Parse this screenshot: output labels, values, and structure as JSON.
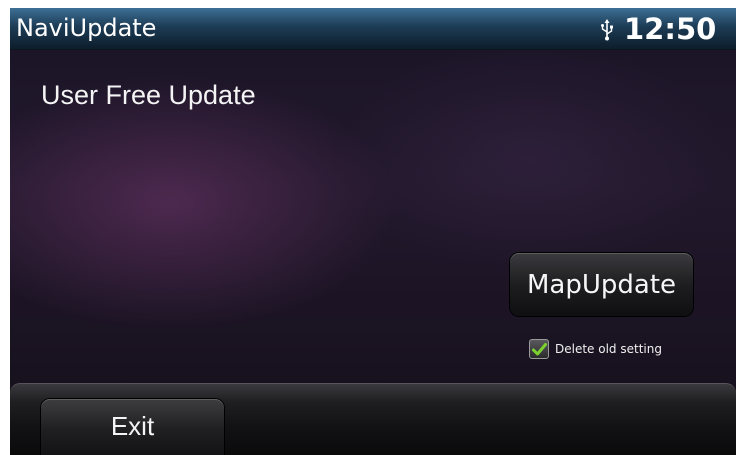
{
  "status_bar": {
    "app_title": "NaviUpdate",
    "usb_icon": "usb-icon",
    "clock": "12:50"
  },
  "main": {
    "heading": "User Free Update",
    "map_update_button": "MapUpdate",
    "delete_old_setting": {
      "label": "Delete old setting",
      "checked": true,
      "check_icon": "check-icon"
    }
  },
  "bottom_bar": {
    "exit_button": "Exit"
  },
  "colors": {
    "status_bar_top": "#3d6f95",
    "status_bar_bottom": "#0d1d2b",
    "background": "#1a1426",
    "check_green": "#7bd12e"
  }
}
